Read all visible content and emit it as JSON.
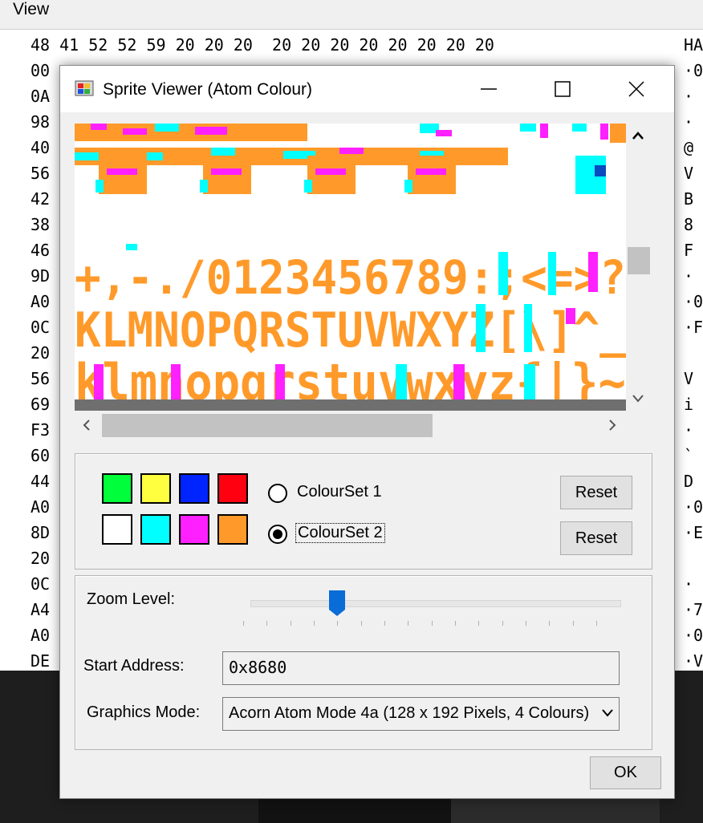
{
  "background": {
    "menu": {
      "view_label": "View"
    },
    "hex_rows": [
      {
        "bytes": "48 41 52 52 59 20 20 20  20 20 20 20 20 20 20 20",
        "ascii": "HA"
      },
      {
        "bytes": "00",
        "ascii": "·0"
      },
      {
        "bytes": "0A",
        "ascii": "·"
      },
      {
        "bytes": "98",
        "ascii": "·"
      },
      {
        "bytes": "40",
        "ascii": "@"
      },
      {
        "bytes": "56",
        "ascii": "V"
      },
      {
        "bytes": "42",
        "ascii": "B"
      },
      {
        "bytes": "38",
        "ascii": "8"
      },
      {
        "bytes": "46",
        "ascii": "F"
      },
      {
        "bytes": "9D",
        "ascii": "·"
      },
      {
        "bytes": "A0",
        "ascii": "·0"
      },
      {
        "bytes": "0C",
        "ascii": "·F"
      },
      {
        "bytes": "20",
        "ascii": ""
      },
      {
        "bytes": "56",
        "ascii": "V"
      },
      {
        "bytes": "69",
        "ascii": "i"
      },
      {
        "bytes": "F3",
        "ascii": "·"
      },
      {
        "bytes": "60",
        "ascii": "`"
      },
      {
        "bytes": "44",
        "ascii": "D"
      },
      {
        "bytes": "A0",
        "ascii": "·0"
      },
      {
        "bytes": "8D",
        "ascii": "·E"
      },
      {
        "bytes": "20",
        "ascii": ""
      },
      {
        "bytes": "0C",
        "ascii": "·"
      },
      {
        "bytes": "A4",
        "ascii": "·7"
      },
      {
        "bytes": "A0",
        "ascii": "·0"
      },
      {
        "bytes": "DE",
        "ascii": "·V"
      }
    ]
  },
  "dialog": {
    "title": "Sprite Viewer (Atom Colour)",
    "icons": {
      "app": "sprite-viewer-app-icon",
      "minimize": "minimize-icon",
      "maximize": "maximize-icon",
      "close": "close-icon"
    },
    "sprite_text": {
      "row_digits": "+,-./0123456789:;<=>?",
      "row_upper": "KLMNOPQRSTUVWXYZ[\\]^_",
      "row_lower": "klmnopqrstuvwxyz{|}~"
    },
    "palette": {
      "colourset1": [
        "#00ff3a",
        "#ffff40",
        "#0024ff",
        "#ff0010"
      ],
      "colourset2": [
        "#ffffff",
        "#00ffff",
        "#ff20ff",
        "#ff9a2a"
      ]
    },
    "colourset1_label": "ColourSet 1",
    "colourset2_label": "ColourSet 2",
    "selected_colourset": 2,
    "reset_label_1": "Reset",
    "reset_label_2": "Reset",
    "zoom_label": "Zoom Level:",
    "zoom_level_index": 4,
    "zoom_tick_count": 16,
    "start_address_label": "Start Address:",
    "start_address_value": "0x8680",
    "graphics_mode_label": "Graphics Mode:",
    "graphics_mode_value": "Acorn Atom Mode 4a (128 x 192 Pixels, 4 Colours)",
    "ok_label": "OK"
  }
}
